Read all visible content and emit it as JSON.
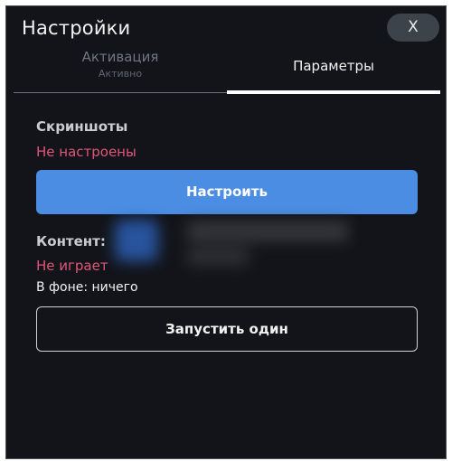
{
  "window": {
    "title": "Настройки",
    "close_label": "X"
  },
  "tabs": [
    {
      "label": "Активация",
      "sublabel": "Активно",
      "active": false
    },
    {
      "label": "Параметры",
      "active": true
    }
  ],
  "screenshots": {
    "label": "Скриншоты",
    "status": "Не настроены",
    "configure_button": "Настроить"
  },
  "content": {
    "label": "Контент:",
    "status": "Не играет",
    "background": "В фоне: ничего",
    "run_button": "Запустить один"
  },
  "colors": {
    "background": "#121419",
    "accent": "#4a8de3",
    "status_error": "#e0567a"
  }
}
